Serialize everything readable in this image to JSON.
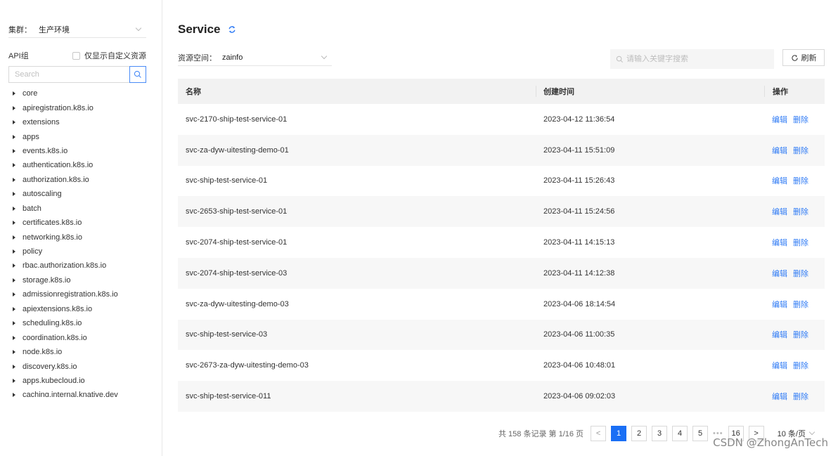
{
  "sidebar": {
    "cluster_label": "集群：",
    "cluster_value": "生产环境",
    "api_group_label": "API组",
    "custom_only_label": "仅显示自定义资源",
    "search_placeholder": "Search",
    "api_groups": [
      "core",
      "apiregistration.k8s.io",
      "extensions",
      "apps",
      "events.k8s.io",
      "authentication.k8s.io",
      "authorization.k8s.io",
      "autoscaling",
      "batch",
      "certificates.k8s.io",
      "networking.k8s.io",
      "policy",
      "rbac.authorization.k8s.io",
      "storage.k8s.io",
      "admissionregistration.k8s.io",
      "apiextensions.k8s.io",
      "scheduling.k8s.io",
      "coordination.k8s.io",
      "node.k8s.io",
      "discovery.k8s.io",
      "apps.kubecloud.io",
      "caching.internal.knative.dev"
    ]
  },
  "header": {
    "title": "Service",
    "namespace_label": "资源空间：",
    "namespace_value": "zainfo",
    "keyword_placeholder": "请输入关键字搜索",
    "refresh_label": "刷新"
  },
  "table": {
    "columns": [
      "名称",
      "创建时间",
      "操作"
    ],
    "edit_label": "编辑",
    "delete_label": "删除",
    "rows": [
      {
        "name": "svc-2170-ship-test-service-01",
        "created": "2023-04-12 11:36:54"
      },
      {
        "name": "svc-za-dyw-uitesting-demo-01",
        "created": "2023-04-11 15:51:09"
      },
      {
        "name": "svc-ship-test-service-01",
        "created": "2023-04-11 15:26:43"
      },
      {
        "name": "svc-2653-ship-test-service-01",
        "created": "2023-04-11 15:24:56"
      },
      {
        "name": "svc-2074-ship-test-service-01",
        "created": "2023-04-11 14:15:13"
      },
      {
        "name": "svc-2074-ship-test-service-03",
        "created": "2023-04-11 14:12:38"
      },
      {
        "name": "svc-za-dyw-uitesting-demo-03",
        "created": "2023-04-06 18:14:54"
      },
      {
        "name": "svc-ship-test-service-03",
        "created": "2023-04-06 11:00:35"
      },
      {
        "name": "svc-2673-za-dyw-uitesting-demo-03",
        "created": "2023-04-06 10:48:01"
      },
      {
        "name": "svc-ship-test-service-011",
        "created": "2023-04-06 09:02:03"
      }
    ]
  },
  "pagination": {
    "summary": "共 158 条记录 第 1/16 页",
    "prev": "<",
    "next": ">",
    "pages": [
      "1",
      "2",
      "3",
      "4",
      "5"
    ],
    "ellipsis": "•••",
    "last_page": "16",
    "page_size": "10 条/页",
    "current_page": "1"
  },
  "watermark": "CSDN @ZhongAnTech",
  "colors": {
    "accent": "#1a6ff5",
    "link": "#2f7bf5",
    "header_bg": "#f2f2f2"
  }
}
